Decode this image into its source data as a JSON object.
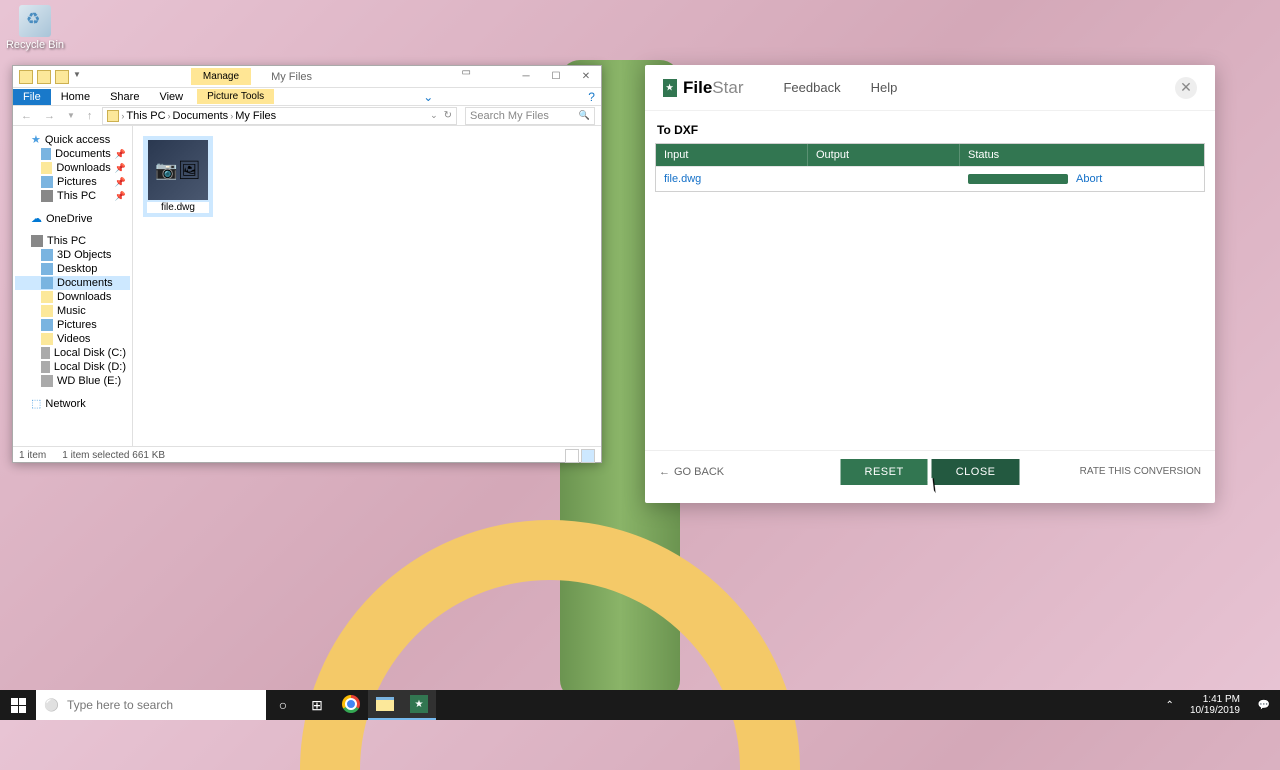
{
  "desktop": {
    "recycle_bin": "Recycle Bin"
  },
  "explorer": {
    "title_tab": "Manage",
    "title_context": "Picture Tools",
    "title_text": "My Files",
    "ribbon": {
      "file": "File",
      "home": "Home",
      "share": "Share",
      "view": "View"
    },
    "breadcrumb": {
      "root": "This PC",
      "p1": "Documents",
      "p2": "My Files"
    },
    "search_placeholder": "Search My Files",
    "tree": {
      "quick_access": "Quick access",
      "documents": "Documents",
      "downloads": "Downloads",
      "pictures": "Pictures",
      "this_pc_q": "This PC",
      "onedrive": "OneDrive",
      "this_pc": "This PC",
      "objects3d": "3D Objects",
      "desktop": "Desktop",
      "documents2": "Documents",
      "downloads2": "Downloads",
      "music": "Music",
      "pictures2": "Pictures",
      "videos": "Videos",
      "drive_c": "Local Disk (C:)",
      "drive_d": "Local Disk (D:)",
      "drive_e": "WD Blue (E:)",
      "network": "Network"
    },
    "file": {
      "name": "file.dwg"
    },
    "status": {
      "items": "1 item",
      "selected": "1 item selected  661 KB"
    }
  },
  "filestar": {
    "logo_main": "File",
    "logo_sub": "Star",
    "menu": {
      "feedback": "Feedback",
      "help": "Help"
    },
    "title": "To DXF",
    "headers": {
      "input": "Input",
      "output": "Output",
      "status": "Status"
    },
    "row": {
      "input": "file.dwg",
      "abort": "Abort"
    },
    "footer": {
      "back": "GO BACK",
      "reset": "RESET",
      "close": "CLOSE",
      "rate": "RATE THIS CONVERSION"
    }
  },
  "taskbar": {
    "search_placeholder": "Type here to search",
    "time": "1:41 PM",
    "date": "10/19/2019"
  }
}
